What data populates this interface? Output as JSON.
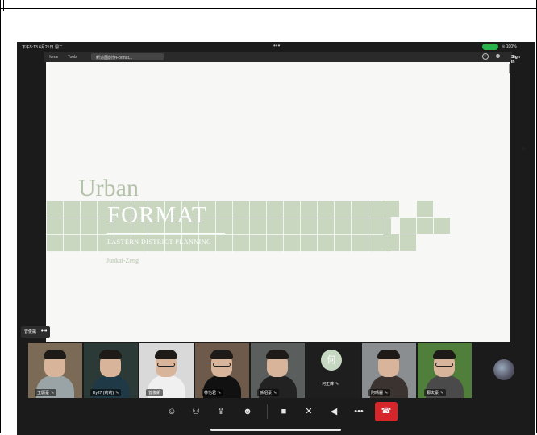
{
  "status_bar": {
    "time_date": "下午5:13  6月21日 週二",
    "dots": "•••",
    "right": "◎ 100%"
  },
  "browser": {
    "nav": [
      "Home",
      "Tools"
    ],
    "tab_label": "新造園創作Format...",
    "tab_close": "×",
    "help": "?",
    "sign_in": "Sign In"
  },
  "slide": {
    "title_line1": "Urban",
    "title_line2": "FORMAT",
    "subtitle": "EASTERN DISTRICT PLANNING",
    "author": "Junkai-Zeng",
    "accent_color": "#c9d6c0"
  },
  "speaker": {
    "name": "曾俊凱",
    "more": "•••"
  },
  "participants": [
    {
      "name": "王顥豪",
      "bg": "#7b6a55",
      "body": "#9aa4a6",
      "hair": true,
      "glasses": false
    },
    {
      "name": "lily27 (莉莉)",
      "bg": "#2b3a36",
      "body": "#1f3a46",
      "hair": true,
      "glasses": false
    },
    {
      "name": "曾俊凱",
      "bg": "#d9d9d9",
      "body": "#f0f0f0",
      "hair": true,
      "glasses": true
    },
    {
      "name": "林怡君",
      "bg": "#6e5a4a",
      "body": "#111111",
      "hair": true,
      "glasses": true
    },
    {
      "name": "孫昭豪",
      "bg": "#5a5f5d",
      "body": "#222222",
      "hair": true,
      "glasses": false
    },
    {
      "name": "何正緯",
      "audio_only": true,
      "initial": "何"
    },
    {
      "name": "阿晴麗",
      "bg": "#8a8e90",
      "body": "#3a3330",
      "hair": true,
      "glasses": false
    },
    {
      "name": "鄭文豪",
      "bg": "#4f7f3a",
      "body": "#4a4a4a",
      "hair": true,
      "glasses": true
    }
  ],
  "mic_muted_icon": "✎",
  "toolbar": {
    "chat": "☺",
    "participants": "⚇",
    "share": "⇪",
    "reactions": "☻",
    "video_off": "■",
    "mic_off": "✕",
    "speaker": "◀",
    "more": "•••",
    "leave": "☎"
  }
}
